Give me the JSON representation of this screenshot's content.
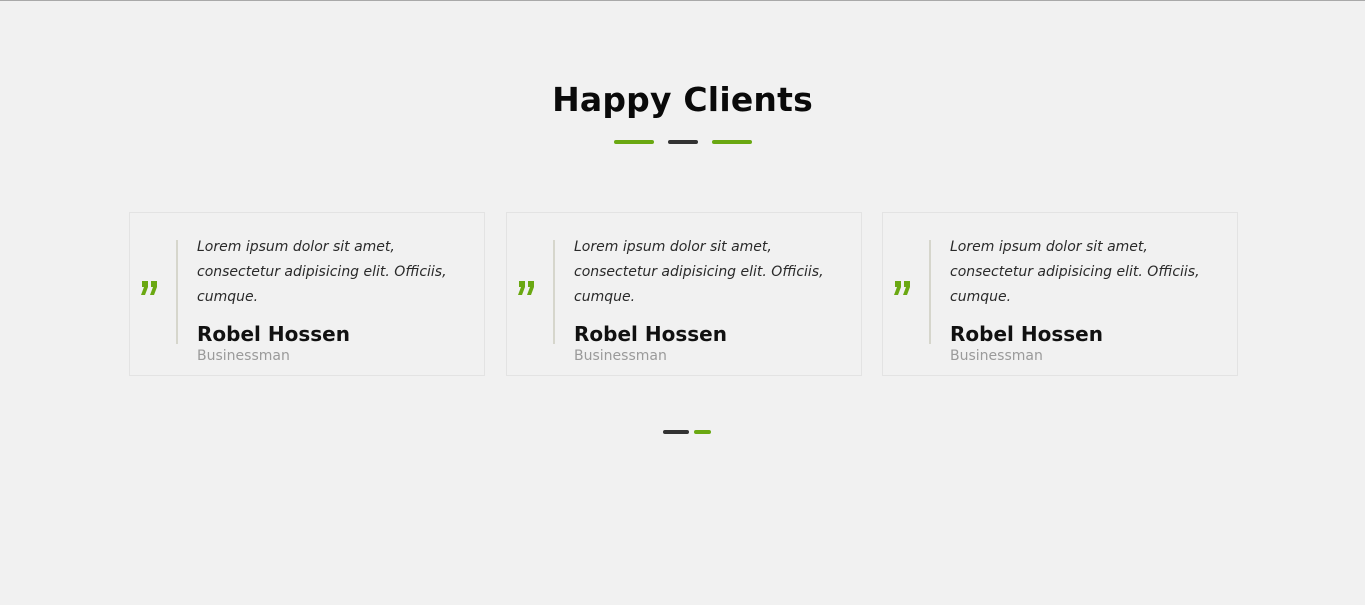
{
  "section": {
    "title": "Happy Clients"
  },
  "colors": {
    "accent": "#6aa812",
    "dark": "#333333",
    "background": "#f1f1f1"
  },
  "testimonials": [
    {
      "quote": "Lorem ipsum dolor sit amet, consectetur adipisicing elit. Officiis, cumque.",
      "name": "Robel Hossen",
      "role": "Businessman",
      "icon": "quote-icon"
    },
    {
      "quote": "Lorem ipsum dolor sit amet, consectetur adipisicing elit. Officiis, cumque.",
      "name": "Robel Hossen",
      "role": "Businessman",
      "icon": "quote-icon"
    },
    {
      "quote": "Lorem ipsum dolor sit amet, consectetur adipisicing elit. Officiis, cumque.",
      "name": "Robel Hossen",
      "role": "Businessman",
      "icon": "quote-icon"
    }
  ],
  "pager": {
    "pages": 2,
    "active_index": 1
  }
}
